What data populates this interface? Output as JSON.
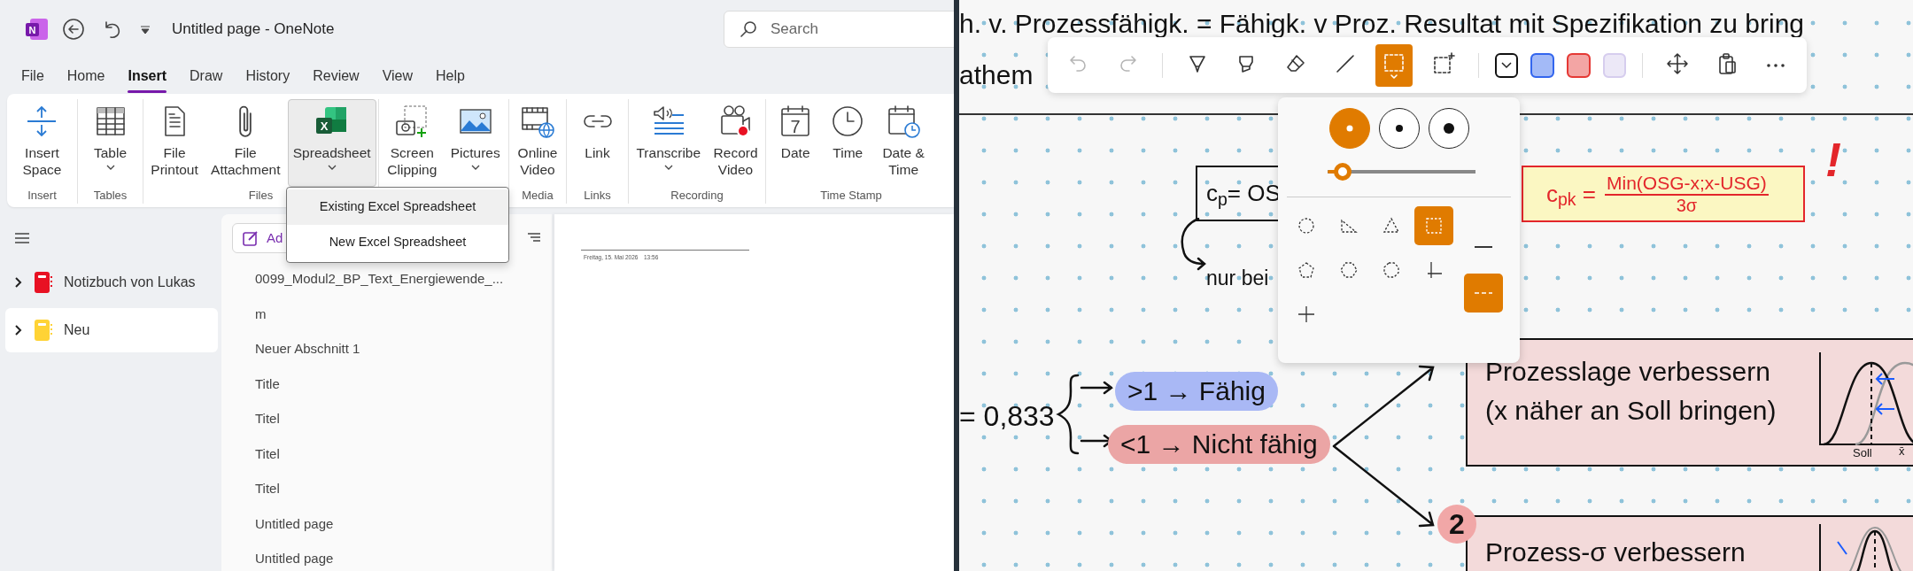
{
  "app_logo": {
    "letter": "N"
  },
  "window": {
    "title": "Untitled page  -  OneNote"
  },
  "search": {
    "placeholder": "Search"
  },
  "menu_tabs": [
    {
      "label": "File",
      "selected": false
    },
    {
      "label": "Home",
      "selected": false
    },
    {
      "label": "Insert",
      "selected": true
    },
    {
      "label": "Draw",
      "selected": false
    },
    {
      "label": "History",
      "selected": false
    },
    {
      "label": "Review",
      "selected": false
    },
    {
      "label": "View",
      "selected": false
    },
    {
      "label": "Help",
      "selected": false
    }
  ],
  "ribbon_groups": [
    {
      "label": "Insert",
      "buttons": [
        {
          "kind": "insert-space",
          "label": "Insert\nSpace",
          "dropdown": false,
          "pressed": false
        }
      ]
    },
    {
      "label": "Tables",
      "buttons": [
        {
          "kind": "table",
          "label": "Table",
          "dropdown": true,
          "pressed": false
        }
      ]
    },
    {
      "label": "Files",
      "buttons": [
        {
          "kind": "printout",
          "label": "File\nPrintout",
          "dropdown": false,
          "pressed": false
        },
        {
          "kind": "attachment",
          "label": "File\nAttachment",
          "dropdown": false,
          "pressed": false
        },
        {
          "kind": "spreadsheet",
          "label": "Spreadsheet",
          "icon_text": "X",
          "dropdown": true,
          "pressed": true
        }
      ]
    },
    {
      "buttons": [
        {
          "kind": "screen-clipping",
          "label": "Screen\nClipping",
          "dropdown": false,
          "pressed": false
        },
        {
          "kind": "pictures",
          "label": "Pictures",
          "dropdown": true,
          "pressed": false
        }
      ]
    },
    {
      "label": "Media",
      "buttons": [
        {
          "kind": "online-video",
          "label": "Online\nVideo",
          "dropdown": false,
          "pressed": false
        }
      ]
    },
    {
      "label": "Links",
      "buttons": [
        {
          "kind": "link",
          "label": "Link",
          "dropdown": false,
          "pressed": false
        }
      ]
    },
    {
      "label": "Recording",
      "buttons": [
        {
          "kind": "transcribe",
          "label": "Transcribe",
          "dropdown": true,
          "pressed": false
        },
        {
          "kind": "record-video",
          "label": "Record\nVideo",
          "dropdown": false,
          "pressed": false
        }
      ]
    },
    {
      "label": "Time Stamp",
      "buttons": [
        {
          "kind": "date",
          "label": "Date",
          "icon_text": "7",
          "dropdown": false,
          "pressed": false
        },
        {
          "kind": "time",
          "label": "Time",
          "dropdown": false,
          "pressed": false
        },
        {
          "kind": "date-time",
          "label": "Date &\nTime",
          "dropdown": false,
          "pressed": false
        }
      ]
    }
  ],
  "dropdown_menu": [
    {
      "label": "Existing Excel Spreadsheet",
      "selected": true
    },
    {
      "label": "New Excel Spreadsheet",
      "selected": false
    }
  ],
  "sidebar": {
    "notebooks": [
      {
        "name": "Notizbuch von Lukas",
        "color": "#e81123",
        "selected": false
      },
      {
        "name": "Neu",
        "color": "#ffd335",
        "selected": true
      }
    ]
  },
  "page_list": {
    "add_button": "Ad",
    "pages": [
      "0099_Modul2_BP_Text_Energiewende_...",
      "m",
      "Neuer Abschnitt 1",
      "Title",
      "Titel",
      "Titel",
      "Titel",
      "Untitled page",
      "Untitled page"
    ]
  },
  "page": {
    "date": "Freitag, 15. Mai 2026",
    "time": "13:56"
  },
  "ink_toolbar": {
    "tools": [
      {
        "kind": "undo",
        "selected": false,
        "disabled": true
      },
      {
        "kind": "redo",
        "selected": false,
        "disabled": true
      },
      {
        "kind": "pen",
        "selected": false,
        "disabled": false
      },
      {
        "kind": "highlighter",
        "selected": false,
        "disabled": false
      },
      {
        "kind": "eraser",
        "selected": false,
        "disabled": false
      },
      {
        "kind": "line",
        "selected": false,
        "disabled": false
      },
      {
        "kind": "lasso",
        "selected": true,
        "disabled": false
      },
      {
        "kind": "add-space",
        "selected": false,
        "disabled": false
      }
    ],
    "pens": [
      {
        "color": "#111111",
        "selected": true
      },
      {
        "color": "#3366ee",
        "selected": false
      },
      {
        "color": "#e53935",
        "selected": false
      },
      {
        "color": "#d6cdee",
        "selected": false
      }
    ],
    "actions": [
      {
        "kind": "move"
      },
      {
        "kind": "paste"
      },
      {
        "kind": "more"
      }
    ]
  },
  "shape_popup": {
    "thickness": [
      {
        "selected": true
      },
      {
        "selected": false
      },
      {
        "selected": false
      }
    ],
    "slider": {
      "level": 0.1
    },
    "shapes": [
      {
        "kind": "circle",
        "selected": false
      },
      {
        "kind": "right-triangle",
        "selected": false
      },
      {
        "kind": "triangle",
        "selected": false
      },
      {
        "kind": "rectangle",
        "selected": true
      },
      {
        "kind": "pentagon",
        "selected": false
      },
      {
        "kind": "hexagon",
        "selected": false
      },
      {
        "kind": "octagon",
        "selected": false
      },
      {
        "kind": "axes",
        "selected": false
      },
      {
        "kind": "cross-axes",
        "selected": false
      }
    ],
    "line_styles": [
      {
        "kind": "solid",
        "selected": false
      },
      {
        "kind": "dashed",
        "selected": true
      }
    ]
  },
  "notes": {
    "heading_lines": [
      "h. v. Prozessfähigk. = Fähigk. v Proz. Resultat mit Spezifikation zu bring",
      "athem"
    ],
    "cp_formula": "c$_{p}$= OS",
    "cp_note": "nur bei",
    "cpk_formula": {
      "lhs": "c$_{pk}$ =",
      "numerator": "Min(OSG-x;x-USG)",
      "denominator": "3σ"
    },
    "exclamation": "!",
    "result": "= 0,833",
    "cases": [
      {
        "text": ">1 → Fähig",
        "color": "#a9b8f5"
      },
      {
        "text": "<1 → Nicht fähig",
        "color": "#eba5a5"
      }
    ],
    "measures": [
      {
        "lines": [
          "Prozesslage verbessern",
          "(x näher an Soll bringen)"
        ],
        "graph_labels": [
          "Soll",
          "x̄"
        ]
      },
      {
        "number": "2",
        "lines": [
          "Prozess-σ verbessern"
        ]
      }
    ]
  }
}
